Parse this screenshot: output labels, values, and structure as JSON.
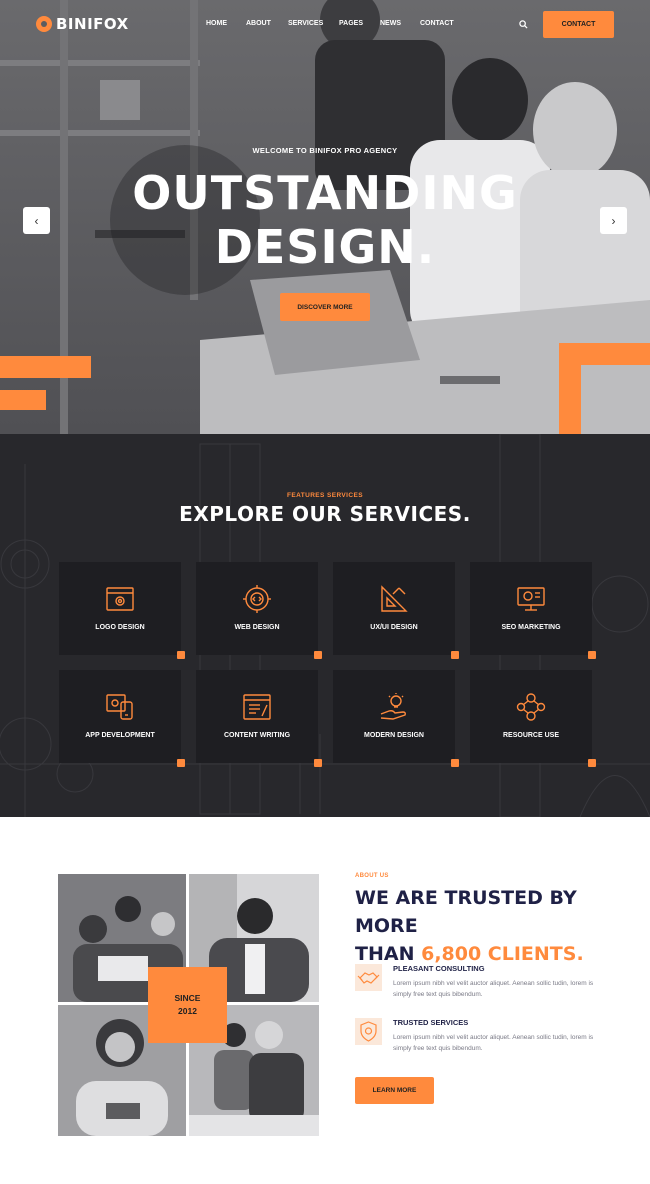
{
  "brand": {
    "name": "BINIFOX",
    "accent": "#ff8a3d",
    "dark": "#28282c",
    "navy": "#1f2146"
  },
  "nav": {
    "items": [
      "HOME",
      "ABOUT",
      "SERVICES",
      "PAGES",
      "NEWS",
      "CONTACT"
    ],
    "search_icon": "search-icon",
    "cta_label": "CONTACT"
  },
  "hero": {
    "subtitle": "WELCOME TO BINIFOX PRO AGENCY",
    "title_line1": "OUTSTANDING",
    "title_line2": "DESIGN.",
    "button_label": "DISCOVER MORE",
    "prev_icon": "chevron-left-icon",
    "next_icon": "chevron-right-icon"
  },
  "services": {
    "kicker": "FEATURES SERVICES",
    "title": "EXPLORE OUR SERVICES.",
    "cards": [
      {
        "label": "LOGO DESIGN",
        "icon": "browser-gear-icon"
      },
      {
        "label": "WEB DESIGN",
        "icon": "gear-code-icon"
      },
      {
        "label": "UX/UI DESIGN",
        "icon": "ruler-pencil-icon"
      },
      {
        "label": "SEO MARKETING",
        "icon": "monitor-chart-icon"
      },
      {
        "label": "APP DEVELOPMENT",
        "icon": "app-devices-icon"
      },
      {
        "label": "CONTENT WRITING",
        "icon": "document-pen-icon"
      },
      {
        "label": "MODERN DESIGN",
        "icon": "hand-bulb-icon"
      },
      {
        "label": "RESOURCE USE",
        "icon": "network-people-icon"
      }
    ]
  },
  "about": {
    "kicker": "ABOUT US",
    "title_part1": "WE ARE TRUSTED BY MORE",
    "title_part2": "THAN",
    "title_highlight": "6,800 CLIENTS.",
    "since_line1": "SINCE",
    "since_line2": "2012",
    "features": [
      {
        "title": "PLEASANT CONSULTING",
        "icon": "handshake-icon",
        "text": "Lorem ipsum nibh vel velit auctor aliquet. Aenean sollic tudin, lorem is simply free text quis bibendum."
      },
      {
        "title": "TRUSTED SERVICES",
        "icon": "shield-gear-icon",
        "text": "Lorem ipsum nibh vel velit auctor aliquet. Aenean sollic tudin, lorem is simply free text quis bibendum."
      }
    ],
    "button_label": "LEARN MORE"
  }
}
